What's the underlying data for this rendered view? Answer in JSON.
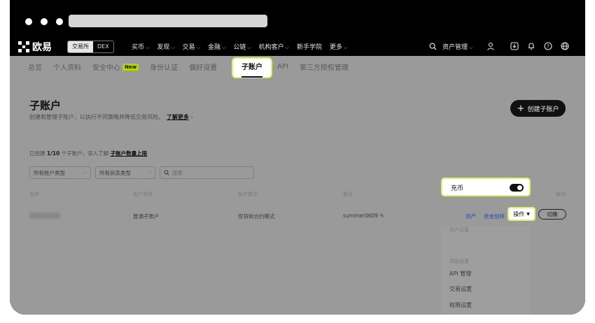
{
  "brand": {
    "name": "欧易"
  },
  "mode_switch": {
    "exchange": "交易所",
    "dex": "DEX"
  },
  "nav": {
    "items": [
      {
        "label": "买币"
      },
      {
        "label": "发现"
      },
      {
        "label": "交易"
      },
      {
        "label": "金融"
      },
      {
        "label": "公链"
      },
      {
        "label": "机构客户"
      },
      {
        "label": "新手学院"
      },
      {
        "label": "更多"
      }
    ],
    "asset_menu": "资产管理"
  },
  "tabs": {
    "items": [
      "总览",
      "个人资料",
      "安全中心",
      "身份认证",
      "偏好设置"
    ],
    "new_badge": "New",
    "active": "子账户",
    "after": [
      "API",
      "第三方授权管理"
    ]
  },
  "page": {
    "title": "子账户",
    "subtitle": "创建和管理子账户，以执行不同策略并降低交易风险。",
    "learn_more": "了解更多",
    "create_button": "创建子账户",
    "count_prefix": "已创建",
    "count_value": "1/10",
    "count_suffix": "个子账户，深入了解",
    "count_link": "子账户数量上限"
  },
  "filters": {
    "account_type": "所有账户类型",
    "status_type": "所有状态类型",
    "search_placeholder": "搜索"
  },
  "table": {
    "headers": [
      "名称",
      "账户类型",
      "账户模式",
      "备注",
      "操作"
    ],
    "row": {
      "name": "xxxxxxxxxx",
      "type": "普通子账户",
      "mode": "现货和合约模式",
      "note": "summer0609",
      "asset": "资产",
      "transfer": "资金划转",
      "operate": "操作",
      "switch": "切换"
    }
  },
  "dropdown": {
    "section1": "资产设置",
    "deposit": "充币",
    "section2": "高级设置",
    "items": [
      "API 管理",
      "交易设置",
      "权限设置"
    ]
  }
}
